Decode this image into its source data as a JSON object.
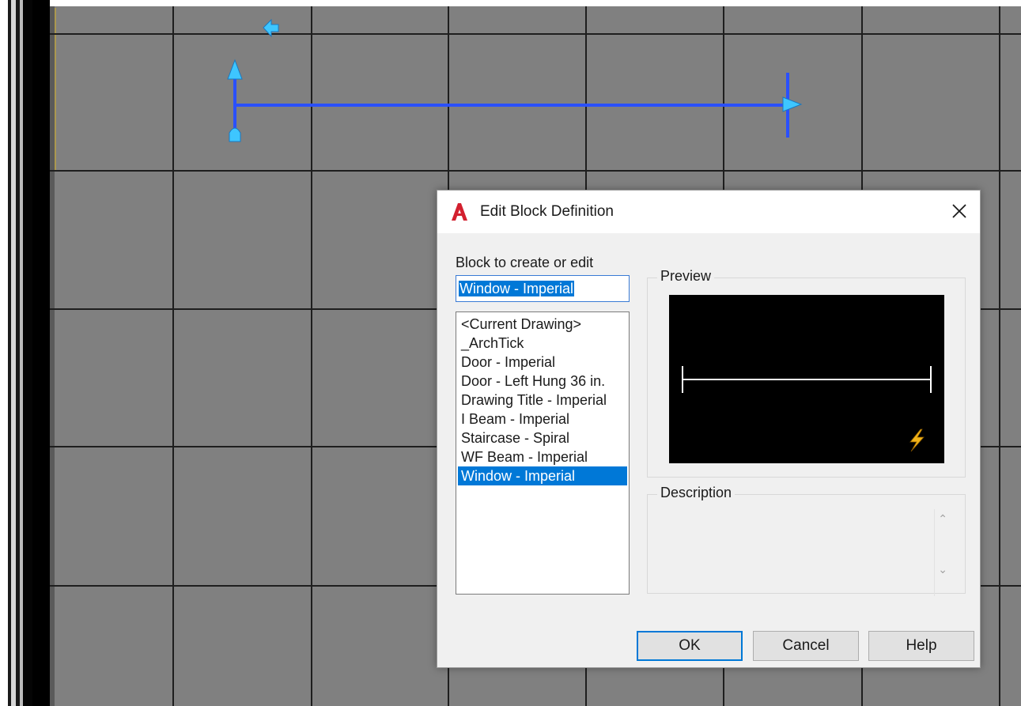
{
  "dialog": {
    "title": "Edit Block Definition",
    "block_label": "Block to create or edit",
    "block_name_value": "Window - Imperial",
    "blocks": [
      "<Current Drawing>",
      "_ArchTick",
      "Door - Imperial",
      "Door - Left Hung 36 in.",
      "Drawing Title - Imperial",
      "I Beam - Imperial",
      "Staircase - Spiral",
      "WF Beam - Imperial",
      "Window - Imperial"
    ],
    "selected_block": "Window - Imperial",
    "preview_label": "Preview",
    "description_label": "Description",
    "description_value": "",
    "buttons": {
      "ok": "OK",
      "cancel": "Cancel",
      "help": "Help"
    }
  },
  "colors": {
    "canvas_background": "#808080",
    "grid_line": "#1e1e1e",
    "selected_geometry": "#2a50ff",
    "grip": "#3ec6ff",
    "selection_highlight": "#0078d7",
    "app_icon": "#d3202f"
  },
  "icons": {
    "app": "autocad-logo-icon",
    "close": "close-icon",
    "block_authoring": "lightning-bolt-icon"
  }
}
